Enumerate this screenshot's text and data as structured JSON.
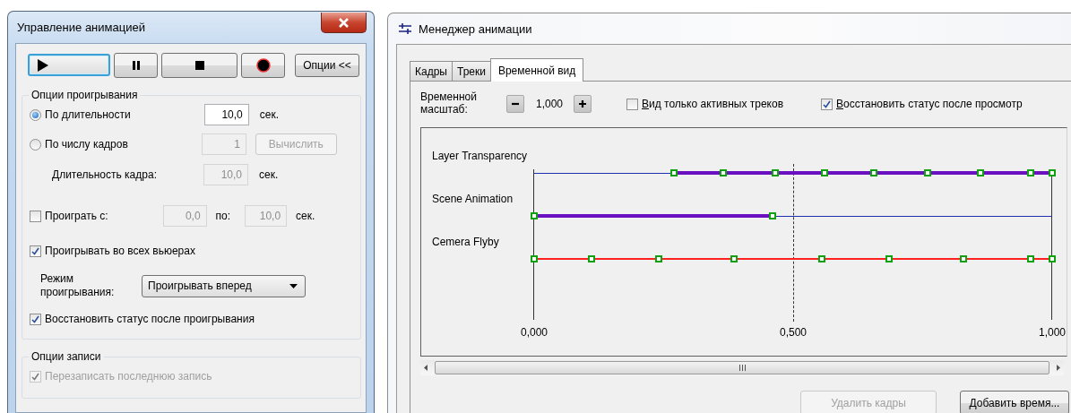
{
  "left_window": {
    "title": "Управление анимацией",
    "transport": [
      {
        "kind": "play",
        "selected": true
      },
      {
        "kind": "pause",
        "selected": false
      },
      {
        "kind": "stop",
        "selected": false
      },
      {
        "kind": "record",
        "selected": false
      }
    ],
    "options_button": "Опции <<",
    "playback_options": {
      "title": "Опции проигрывания",
      "by_duration": {
        "label": "По длительности",
        "selected": true,
        "value": "10,0",
        "unit": "сек."
      },
      "by_frames": {
        "label": "По числу кадров",
        "selected": false,
        "value": "1",
        "button": "Вычислить"
      },
      "frame_duration": {
        "label": "Длительность кадра:",
        "value": "10,0",
        "unit": "сек."
      },
      "play_range": {
        "label": "Проиграть с:",
        "checked": false,
        "from": "0,0",
        "to_label": "по:",
        "to": "10,0",
        "unit": "сек."
      },
      "all_viewers": {
        "label": "Проигрывать во всех вьюерах",
        "checked": true
      },
      "mode": {
        "label": "Режим проигрывания:",
        "value": "Проигрывать вперед"
      },
      "restore": {
        "label": "Восстановить статус после проигрывания",
        "checked": true
      }
    },
    "record_options": {
      "title": "Опции записи",
      "overwrite": {
        "label": "Перезаписать последнюю запись",
        "checked": true,
        "disabled": true
      }
    }
  },
  "right_window": {
    "title": "Менеджер анимации",
    "tabs": [
      {
        "label": "Кадры",
        "selected": false
      },
      {
        "label": "Треки",
        "selected": false
      },
      {
        "label": "Временной вид",
        "selected": true
      }
    ],
    "time_scale": {
      "label": "Временной масштаб:",
      "value": "1,000"
    },
    "active_only": {
      "label": "Вид только активных треков",
      "checked": false
    },
    "restore": {
      "label": "Восстановить статус после просмотр",
      "checked": true
    },
    "timeline": {
      "ticks": [
        "0,000",
        "0,500",
        "1,000"
      ],
      "cursor": {
        "level": 0.5
      },
      "tracks": [
        {
          "name": "Layer Transparency",
          "keyframes": [
            {
              "level": 0.27
            },
            {
              "level": 0.365
            },
            {
              "level": 0.465
            },
            {
              "level": 0.56
            },
            {
              "level": 0.655
            },
            {
              "level": 0.76
            },
            {
              "level": 0.862
            },
            {
              "level": 0.958
            },
            {
              "level": 1
            }
          ],
          "segments": [
            {
              "kind": "inactive",
              "color": "#2030b0",
              "level": 0.27
            },
            {
              "kind": "active",
              "color": "#6a10c0",
              "level": 0.73
            }
          ]
        },
        {
          "name": "Scene Animation",
          "keyframes": [
            {
              "level": 0
            },
            {
              "level": 0.46
            }
          ],
          "segments": [
            {
              "kind": "active",
              "color": "#6a10c0",
              "level": 0.46
            },
            {
              "kind": "inactive",
              "color": "#2030b0",
              "level": 0.54
            }
          ]
        },
        {
          "name": "Cemera Flyby",
          "keyframes": [
            {
              "level": 0
            },
            {
              "level": 0.11
            },
            {
              "level": 0.24
            },
            {
              "level": 0.385
            },
            {
              "level": 0.555
            },
            {
              "level": 0.685
            },
            {
              "level": 0.828
            },
            {
              "level": 0.958
            },
            {
              "level": 1
            }
          ],
          "segments": [
            {
              "kind": "plain",
              "color": "#ff2020",
              "level": 1
            }
          ]
        }
      ]
    },
    "buttons": [
      {
        "label": "Удалить кадры",
        "disabled": true
      },
      {
        "label": "Добавить время...",
        "disabled": false
      }
    ]
  }
}
